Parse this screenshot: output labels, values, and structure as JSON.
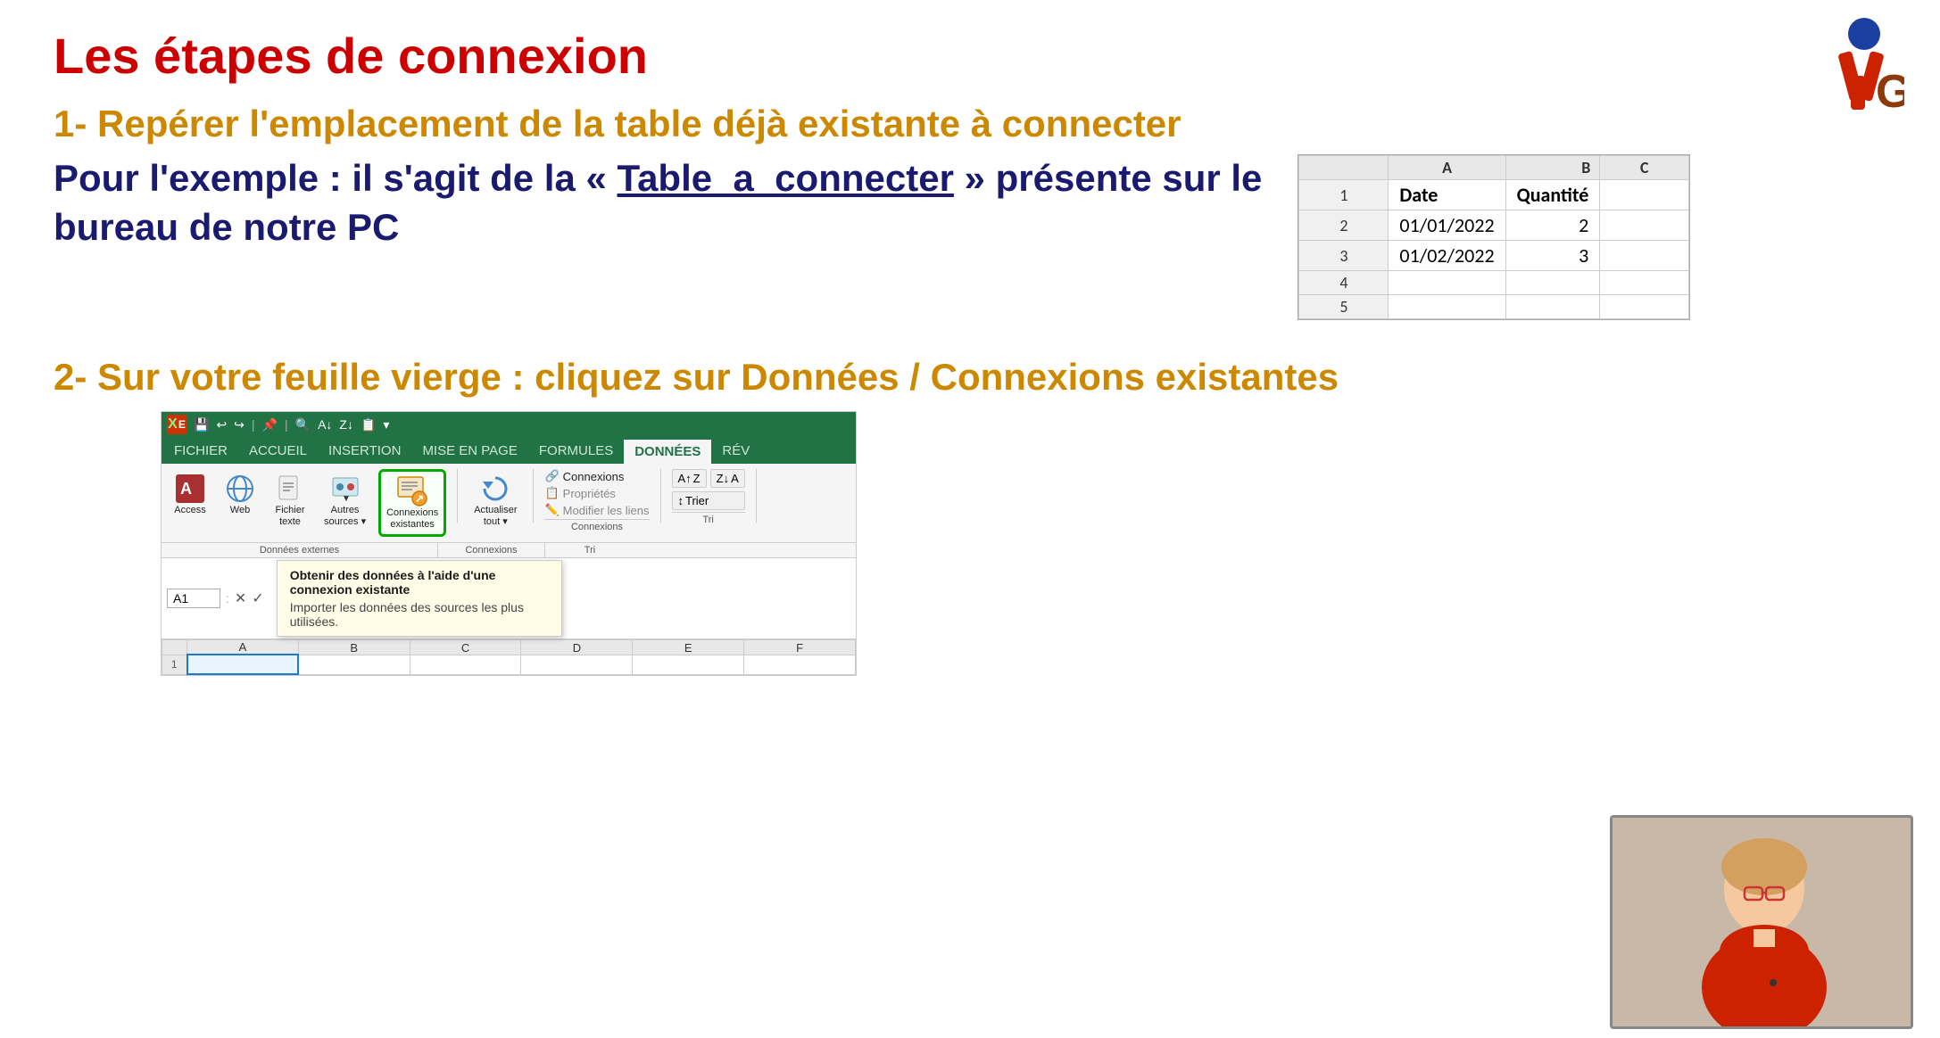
{
  "page": {
    "title": "Les étapes de connexion",
    "background": "#ffffff"
  },
  "logo": {
    "alt": "YG logo"
  },
  "step1": {
    "label": "1- Repérer l'emplacement de la table déjà existante à connecter",
    "description_line1": "Pour l'exemple : il s'agit de la « Table_a_connecter » présente sur le",
    "description_line2": "bureau de notre PC",
    "table": {
      "col_headers": [
        "",
        "A",
        "B",
        "C"
      ],
      "rows": [
        {
          "num": "1",
          "a": "Date",
          "b": "Quantité",
          "c": ""
        },
        {
          "num": "2",
          "a": "01/01/2022",
          "b": "2",
          "c": ""
        },
        {
          "num": "3",
          "a": "01/02/2022",
          "b": "3",
          "c": ""
        },
        {
          "num": "4",
          "a": "",
          "b": "",
          "c": ""
        },
        {
          "num": "5",
          "a": "",
          "b": "",
          "c": ""
        }
      ]
    }
  },
  "step2": {
    "label": "2- Sur votre feuille vierge : cliquez sur Données / Connexions existantes",
    "ribbon": {
      "excel_icon": "X",
      "tabs": [
        "FICHIER",
        "ACCUEIL",
        "INSERTION",
        "MISE EN PAGE",
        "FORMULES",
        "DONNÉES",
        "RÉV"
      ],
      "active_tab": "DONNÉES",
      "groups": {
        "donnees_externes": {
          "label": "Données externes",
          "items": [
            {
              "id": "access",
              "label": "Access",
              "icon": "A"
            },
            {
              "id": "web",
              "label": "Web",
              "icon": "🌐"
            },
            {
              "id": "fichier_texte",
              "label": "Fichier\ntexte",
              "icon": "📄"
            },
            {
              "id": "autres_sources",
              "label": "Autres\nsources ▾",
              "icon": "🔽"
            },
            {
              "id": "connexions_existantes",
              "label": "Connexions\nexistantes",
              "icon": "📋",
              "highlighted": true
            }
          ]
        },
        "connexions": {
          "label": "Connexions",
          "items": [
            {
              "id": "connexions",
              "label": "Connexions",
              "icon": "🔗"
            },
            {
              "id": "proprietes",
              "label": "Propriétés",
              "icon": "📋"
            },
            {
              "id": "modifier_liens",
              "label": "Modifier les liens",
              "icon": "🔗"
            },
            {
              "id": "actualiser_tout",
              "label": "Actualiser\ntout ▾",
              "icon": "🔄"
            }
          ]
        },
        "trier": {
          "label": "Tri",
          "items": [
            {
              "id": "sort_az",
              "label": "A→Z",
              "icon": "↑"
            },
            {
              "id": "sort_za",
              "label": "Z→A",
              "icon": "↓"
            },
            {
              "id": "trier",
              "label": "Trier",
              "icon": "↕"
            }
          ]
        }
      },
      "formula_bar": {
        "name_box": "A1",
        "value": ""
      },
      "sheet": {
        "col_headers": [
          "",
          "A",
          "B",
          "C",
          "D",
          "E",
          "F"
        ],
        "rows": [
          {
            "num": "1",
            "cells": [
              "",
              "",
              "",
              "",
              "",
              ""
            ]
          }
        ]
      },
      "tooltip": {
        "title": "Obtenir des données à l'aide d'une connexion existante",
        "text": "Importer les données des sources les plus utilisées."
      }
    }
  },
  "webcam": {
    "alt": "Presenter webcam"
  }
}
